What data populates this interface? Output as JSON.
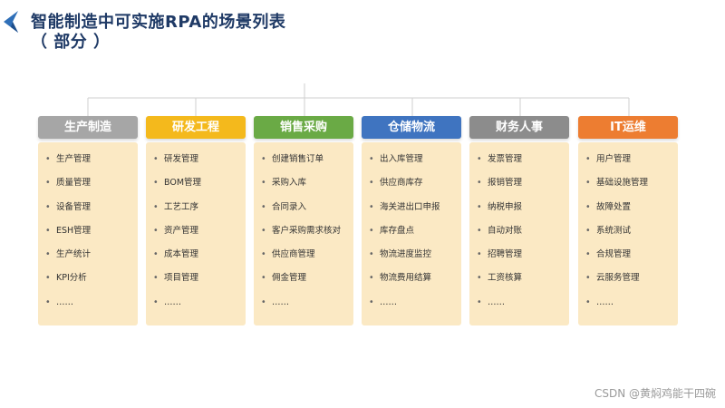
{
  "title": {
    "line1": "智能制造中可实施RPA的场景列表",
    "line2": "（ 部分 ）"
  },
  "watermark": "CSDN @黄焖鸡能干四碗",
  "bullet_symbol": "•",
  "columns": [
    {
      "label": "生产制造",
      "color": "#a6a6a6",
      "items": [
        "生产管理",
        "质量管理",
        "设备管理",
        "ESH管理",
        "生产统计",
        "KPI分析",
        "……"
      ]
    },
    {
      "label": "研发工程",
      "color": "#f4b91c",
      "items": [
        "研发管理",
        "BOM管理",
        "工艺工序",
        "资产管理",
        "成本管理",
        "项目管理",
        "……"
      ]
    },
    {
      "label": "销售采购",
      "color": "#6aaa45",
      "items": [
        "创建销售订单",
        "采购入库",
        "合同录入",
        "客户采购需求核对",
        "供应商管理",
        "佣金管理",
        "……"
      ]
    },
    {
      "label": "仓储物流",
      "color": "#3f74c0",
      "items": [
        "出入库管理",
        "供应商库存",
        "海关进出口申报",
        "库存盘点",
        "物流进度监控",
        "物流费用结算",
        "……"
      ]
    },
    {
      "label": "财务人事",
      "color": "#8c8c8c",
      "items": [
        "发票管理",
        "报销管理",
        "纳税申报",
        "自动对账",
        "招聘管理",
        "工资核算",
        "……"
      ]
    },
    {
      "label": "IT运维",
      "color": "#ed7d31",
      "items": [
        "用户管理",
        "基础设施管理",
        "故障处置",
        "系统测试",
        "合规管理",
        "云服务管理",
        "……"
      ]
    }
  ]
}
